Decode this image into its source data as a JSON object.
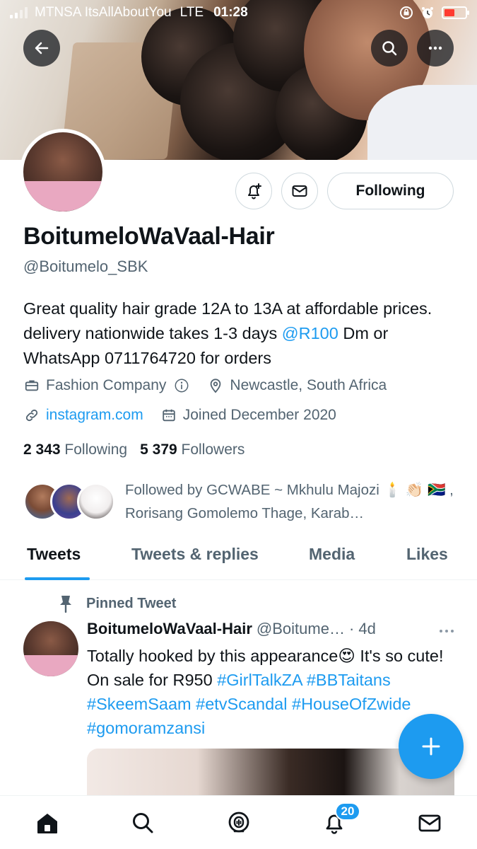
{
  "status_bar": {
    "carrier": "MTNSA ItsAllAboutYou",
    "network": "LTE",
    "time": "01:28"
  },
  "profile": {
    "display_name": "BoitumeloWaVaal-Hair",
    "handle": "@Boitumelo_SBK",
    "bio_pre": "Great quality hair grade 12A to 13A at affordable prices. delivery nationwide takes 1-3 days ",
    "bio_mention": "@R100",
    "bio_post": " Dm or WhatsApp 0711764720 for orders",
    "category": "Fashion Company",
    "location": "Newcastle, South Africa",
    "website": "instagram.com",
    "joined": "Joined December 2020",
    "following_count": "2 343",
    "following_label": "Following",
    "followers_count": "5 379",
    "followers_label": "Followers",
    "follow_button_label": "Following",
    "followed_by": "Followed by GCWABE ~ Mkhulu Majozi 🕯️ 👏🏻 🇿🇦 , Rorisang Gomolemo Thage, Karab…"
  },
  "tabs": [
    "Tweets",
    "Tweets & replies",
    "Media",
    "Likes"
  ],
  "pinned_tweet": {
    "pinned_label": "Pinned Tweet",
    "author_name": "BoitumeloWaVaal-Hair",
    "author_handle": "@Boitume…",
    "age": "· 4d",
    "text_pre": "Totally hooked by this appearance😍 It's so cute! On sale for R950 ",
    "hashtags": "#GirlTalkZA #BBTaitans #SkeemSaam #etvScandal #HouseOfZwide #gomoramzansi"
  },
  "notifications_badge": "20",
  "colors": {
    "accent": "#1d9bf0",
    "text": "#0f1419",
    "muted": "#536471"
  },
  "icons": {
    "back": "arrow-left-icon",
    "search": "search-icon",
    "more": "ellipsis-icon",
    "notify_bell": "bell-plus-icon",
    "message": "envelope-icon",
    "category": "briefcase-icon",
    "info": "info-icon",
    "location": "map-pin-icon",
    "link": "link-icon",
    "calendar": "calendar-icon",
    "pin": "pin-icon",
    "compose": "plus-icon",
    "nav": [
      "home-icon",
      "search-icon",
      "spaces-icon",
      "bell-icon",
      "envelope-icon"
    ]
  }
}
